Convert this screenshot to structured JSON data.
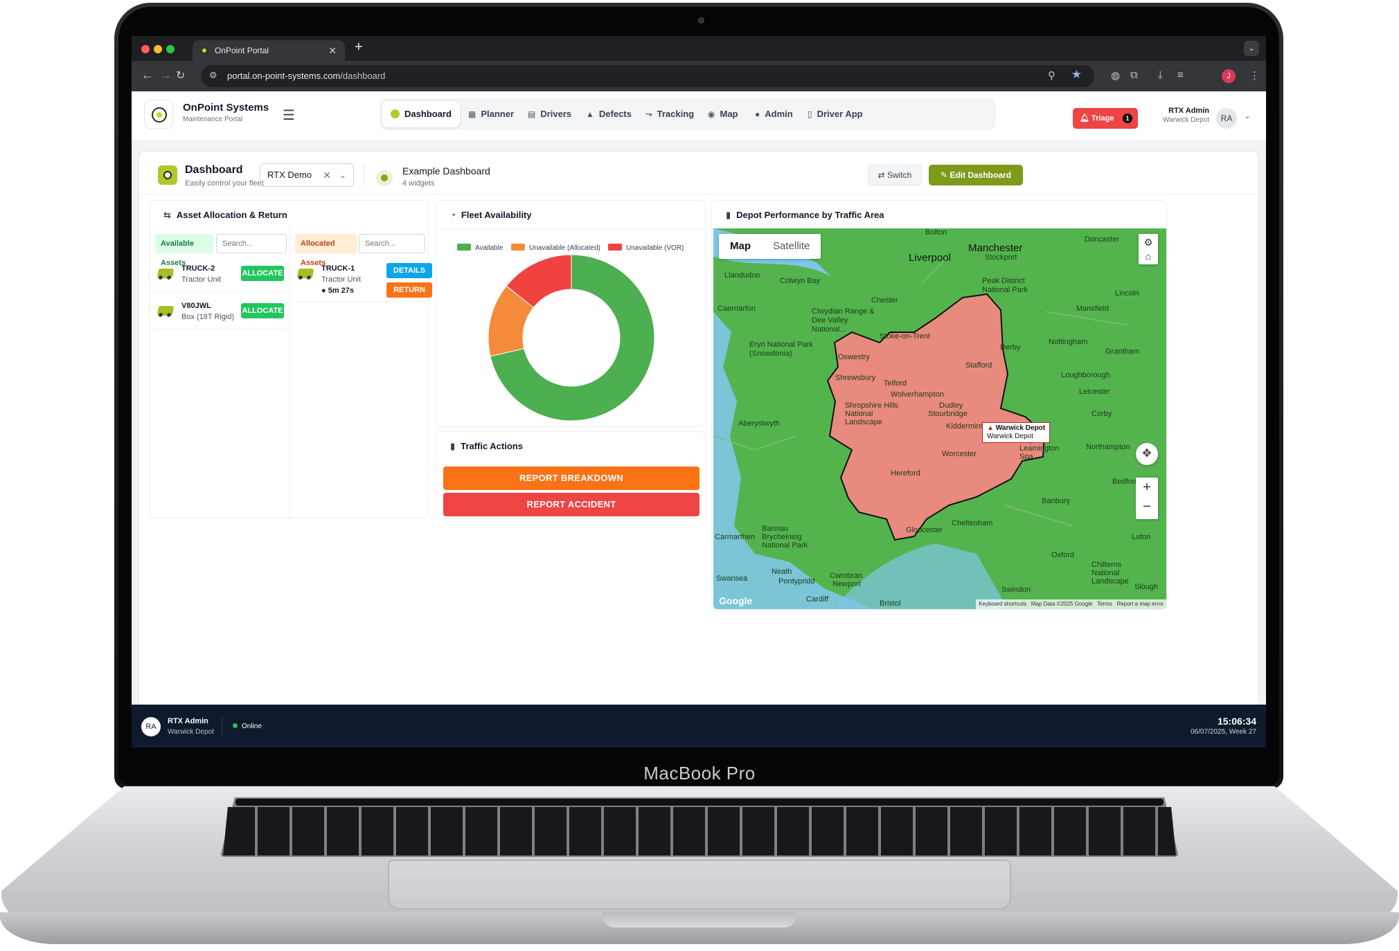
{
  "device": {
    "brand_label": "MacBook Pro"
  },
  "browser": {
    "tab_title": "OnPoint Portal",
    "url_host": "portal.on-point-systems.com",
    "url_path": "/dashboard",
    "profile_initial": "J"
  },
  "app": {
    "brand_title": "OnPoint Systems",
    "brand_subtitle": "Maintenance Portal",
    "nav": [
      {
        "label": "Dashboard",
        "icon": "dashboard-icon",
        "active": true
      },
      {
        "label": "Planner",
        "icon": "calendar-icon"
      },
      {
        "label": "Drivers",
        "icon": "id-card-icon"
      },
      {
        "label": "Defects",
        "icon": "warning-icon"
      },
      {
        "label": "Tracking",
        "icon": "route-icon"
      },
      {
        "label": "Map",
        "icon": "globe-icon"
      },
      {
        "label": "Admin",
        "icon": "user-icon"
      },
      {
        "label": "Driver App",
        "icon": "phone-icon"
      }
    ],
    "triage_label": "Triage",
    "triage_count": "1",
    "user_name": "RTX Admin",
    "user_depot": "Warwick Depot",
    "user_initials": "RA",
    "accent_color": "#7e9a1b"
  },
  "dashboard": {
    "title": "Dashboard",
    "subtitle": "Easily control your fleet",
    "selected_company": "RTX Demo",
    "layout_title": "Example Dashboard",
    "layout_sub": "4 widgets",
    "switch_label": "Switch",
    "edit_label": "Edit Dashboard"
  },
  "asset_widget": {
    "title": "Asset Allocation & Return",
    "available_header": "Available Assets",
    "allocated_header": "Allocated Assets",
    "search_placeholder": "Search...",
    "available": [
      {
        "name": "TRUCK-2",
        "type": "Tractor Unit",
        "action": "ALLOCATE"
      },
      {
        "name": "V80JWL",
        "type": "Box (18T Rigid)",
        "action": "ALLOCATE"
      }
    ],
    "allocated": [
      {
        "name": "TRUCK-1",
        "type": "Tractor Unit",
        "time": "5m 27s",
        "details": "DETAILS",
        "return": "RETURN"
      }
    ]
  },
  "fleet_widget": {
    "title": "Fleet Availability",
    "chart_data": {
      "type": "pie",
      "donut": true,
      "legend_position": "top",
      "series": [
        {
          "name": "Available",
          "value": 5,
          "color": "#4caf50"
        },
        {
          "name": "Unavailable (Allocated)",
          "value": 1,
          "color": "#f58a3a"
        },
        {
          "name": "Unavailable (VOR)",
          "value": 1,
          "color": "#f0423f"
        }
      ]
    }
  },
  "traffic_widget": {
    "title": "Traffic Actions",
    "breakdown_label": "REPORT BREAKDOWN",
    "accident_label": "REPORT ACCIDENT",
    "breakdown_color": "#f97316",
    "accident_color": "#ef4444"
  },
  "map_widget": {
    "title": "Depot Performance by Traffic Area",
    "map_tab": "Map",
    "satellite_tab": "Satellite",
    "depot_label": "Warwick Depot",
    "depot_sub": "Warwick Depot",
    "footer_shortcuts": "Keyboard shortcuts",
    "footer_data": "Map Data ©2025 Google",
    "footer_terms": "Terms",
    "footer_report": "Report a map error",
    "google_mark": "Google",
    "places": [
      "Bolton",
      "Manchester",
      "Liverpool",
      "Stockport",
      "Llandudno",
      "Colwyn Bay",
      "Chester",
      "Caernarfon",
      "Clwydian Range & Dee Valley National...",
      "Peak District National Park",
      "Stoke-on-Trent",
      "Derby",
      "Nottingham",
      "Eryri National Park (Snowdonia)",
      "Oswestry",
      "Stafford",
      "Shrewsbury",
      "Telford",
      "Wolverhampton",
      "Dudley",
      "Stourbridge",
      "Shropshire Hills National Landscape",
      "Kidderminster",
      "Royal Leamington Spa",
      "Worcester",
      "Hereford",
      "Aberystwyth",
      "Leicester",
      "Corby",
      "Northampton",
      "Lincoln",
      "Mansfield",
      "Grantham",
      "Loughborough",
      "Bedford",
      "Banbury",
      "Cheltenham",
      "Gloucester",
      "Bannau Brycheiniog National Park",
      "Carmarthen",
      "Neath",
      "Swansea",
      "Pontypridd",
      "Cwmbran",
      "Newport",
      "Cardiff",
      "Swindon",
      "Oxford",
      "Chilterns National Landscape",
      "Luton",
      "Slough",
      "Bristol",
      "Doncaster"
    ]
  },
  "statusbar": {
    "user_initials": "RA",
    "user_name": "RTX Admin",
    "depot": "Warwick Depot",
    "status": "Online",
    "time": "15:06:34",
    "date": "06/07/2025, Week 27"
  }
}
